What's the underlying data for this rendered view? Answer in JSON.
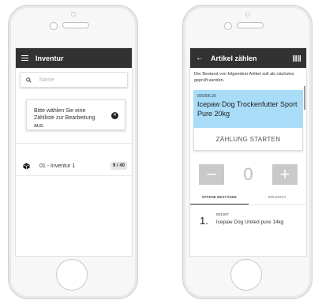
{
  "screen1": {
    "title": "Inventur",
    "search_placeholder": "Name",
    "info_message": "Bitte wählen Sie eine Zählliste zur Bearbeitung aus.",
    "list": [
      {
        "label": "01 - Inventur 1",
        "badge": "9 / 40"
      }
    ]
  },
  "screen2": {
    "title": "Artikel zählen",
    "description": "Der Bestand von folgendem Artikel soll als nächstes geprüft werden.",
    "article": {
      "code": "001006.20",
      "name": "Icepaw Dog Trockenfutter Sport Pure 20kg"
    },
    "start_label": "ZÄHLUNG STARTEN",
    "counter_value": "0",
    "minus_label": "−",
    "plus_label": "+",
    "tabs": [
      "OFFENE BESTÄNDE",
      "ERLEDIGT"
    ],
    "items": [
      {
        "num": "1.",
        "code": "001007",
        "name": "Icepaw Dog United pure 14kg"
      }
    ]
  }
}
